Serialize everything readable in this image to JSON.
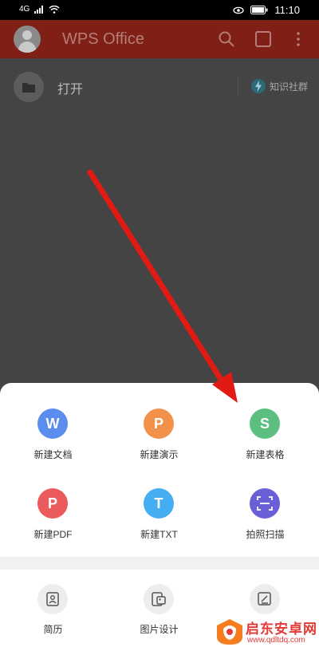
{
  "status_bar": {
    "signal_left": "4G",
    "time": "11:10"
  },
  "app_bar": {
    "title": "WPS Office"
  },
  "open_row": {
    "label": "打开",
    "knowledge_label": "知识社群"
  },
  "new_items": [
    {
      "label": "新建文档",
      "glyph": "W",
      "color": "#5b8def"
    },
    {
      "label": "新建演示",
      "glyph": "P",
      "color": "#f2914a"
    },
    {
      "label": "新建表格",
      "glyph": "S",
      "color": "#5cbf7f"
    },
    {
      "label": "新建PDF",
      "glyph": "P",
      "color": "#ec5b5b"
    },
    {
      "label": "新建TXT",
      "glyph": "T",
      "color": "#45aef3"
    },
    {
      "label": "拍照扫描",
      "glyph": "scan",
      "color": "#6b5fd8"
    }
  ],
  "templates": [
    {
      "label": "简历"
    },
    {
      "label": "图片设计"
    }
  ],
  "watermark": {
    "line1": "启东安卓网",
    "line2": "www.qdltdq.com"
  }
}
